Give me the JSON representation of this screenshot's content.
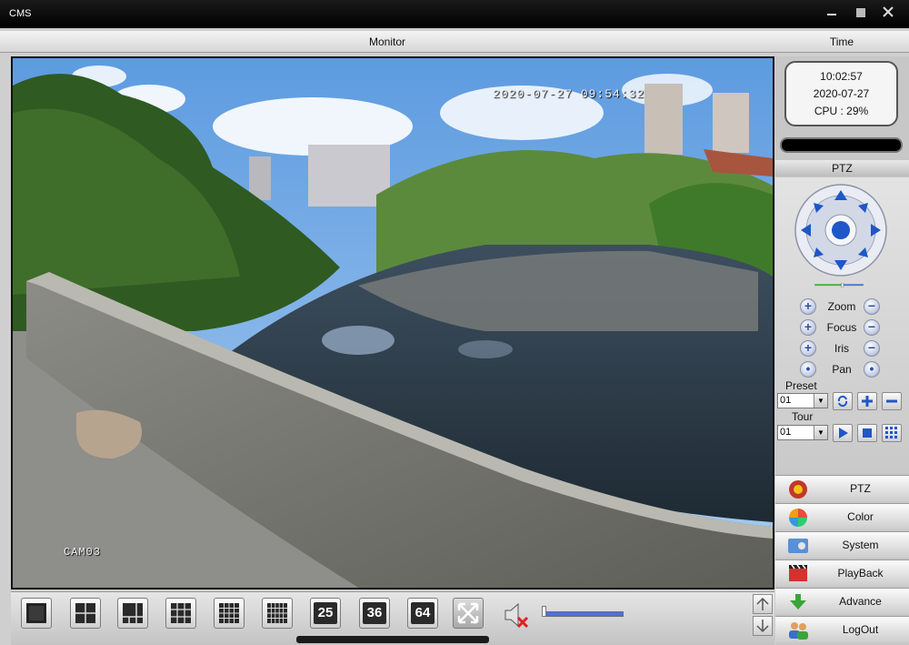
{
  "window": {
    "title": "CMS",
    "controls": [
      "minimize",
      "maximize",
      "close"
    ]
  },
  "header": {
    "monitor_label": "Monitor",
    "time_label": "Time"
  },
  "video": {
    "timestamp_overlay": "2020-07-27 09:54:32",
    "camera_label": "CAM03"
  },
  "clock": {
    "time": "10:02:57",
    "date": "2020-07-27",
    "cpu": "CPU : 29%"
  },
  "ptz": {
    "title": "PTZ",
    "zoom_label": "Zoom",
    "focus_label": "Focus",
    "iris_label": "Iris",
    "pan_label": "Pan",
    "preset_label": "Preset",
    "preset_value": "01",
    "tour_label": "Tour",
    "tour_value": "01"
  },
  "menu": [
    {
      "label": "PTZ",
      "icon": "ptz-icon"
    },
    {
      "label": "Color",
      "icon": "color-icon"
    },
    {
      "label": "System",
      "icon": "system-icon"
    },
    {
      "label": "PlayBack",
      "icon": "playback-icon"
    },
    {
      "label": "Advance",
      "icon": "advance-icon"
    },
    {
      "label": "LogOut",
      "icon": "logout-icon"
    }
  ],
  "toolbar": {
    "layouts": [
      {
        "name": "layout-1-button",
        "icon": "single-view-icon"
      },
      {
        "name": "layout-4-button",
        "icon": "quad-view-icon"
      },
      {
        "name": "layout-6-button",
        "icon": "six-view-icon"
      },
      {
        "name": "layout-9-button",
        "icon": "nine-view-icon"
      },
      {
        "name": "layout-16-button",
        "icon": "sixteen-view-icon"
      },
      {
        "name": "layout-20-button",
        "icon": "twenty-view-icon"
      }
    ],
    "layout_25_label": "25",
    "layout_36_label": "36",
    "layout_64_label": "64",
    "volume_level": 0.0
  },
  "colors": {
    "accent": "#2b4fa5",
    "titlebar": "#000000",
    "volume": "#4b72d8"
  }
}
